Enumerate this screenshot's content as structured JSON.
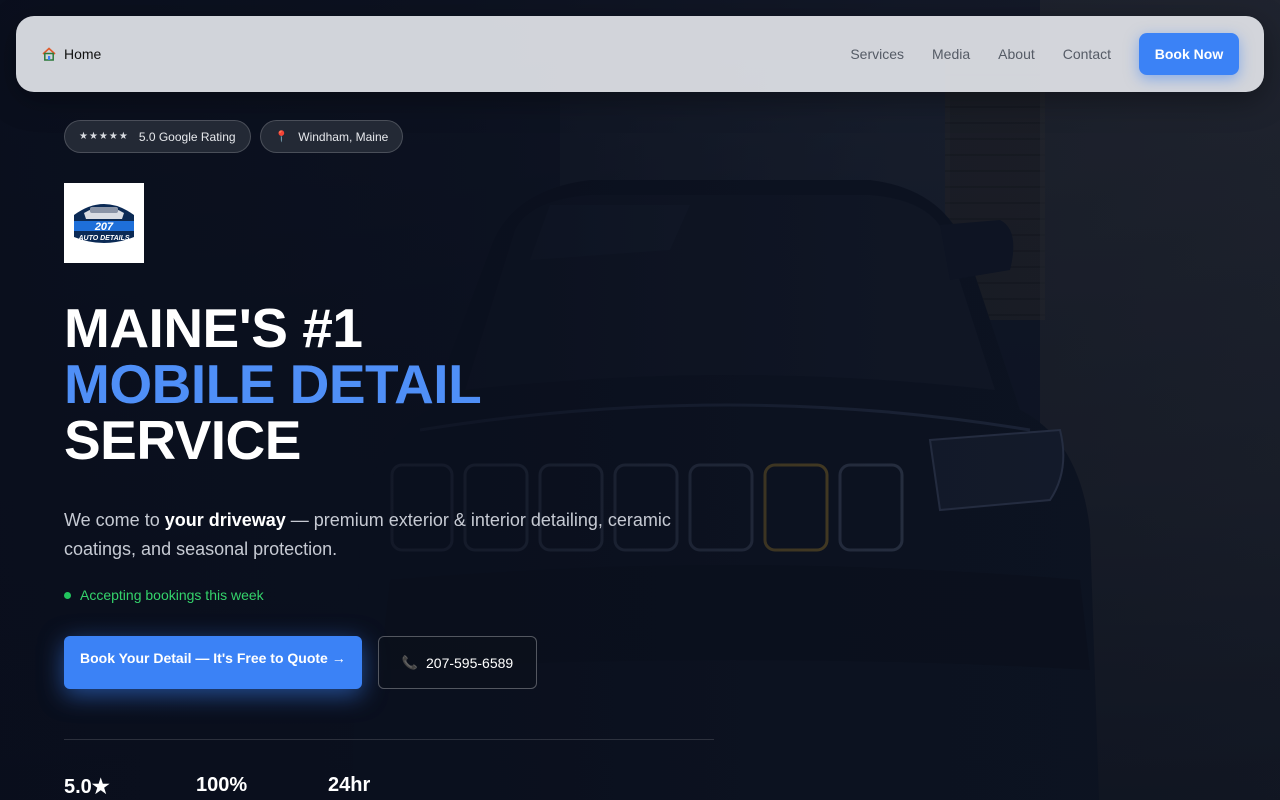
{
  "nav": {
    "home_label": "Home",
    "links": [
      "Services",
      "Media",
      "About",
      "Contact"
    ],
    "cta_label": "Book Now"
  },
  "badges": {
    "rating_stars": "★★★★★",
    "rating_label": "5.0 Google Rating",
    "location_label": "Windham, Maine"
  },
  "logo": {
    "text_line1": "207",
    "text_line2": "AUTO DETAILS"
  },
  "hero": {
    "line1": "MAINE'S #1",
    "line2": "MOBILE DETAIL",
    "line3": "SERVICE",
    "desc_prefix": "We come to ",
    "desc_bold": "your driveway",
    "desc_suffix": " — premium exterior & interior detailing, ceramic coatings, and seasonal protection.",
    "status": "Accepting bookings this week"
  },
  "cta": {
    "primary": "Book Your Detail — It's Free to Quote →",
    "phone": "207-595-6589"
  },
  "stats": [
    "5.0★",
    "100%",
    "24hr"
  ],
  "colors": {
    "accent": "#3b82f6",
    "headline_blue": "#4f8ff7",
    "status_green": "#22c55e",
    "background": "#0b1120"
  }
}
